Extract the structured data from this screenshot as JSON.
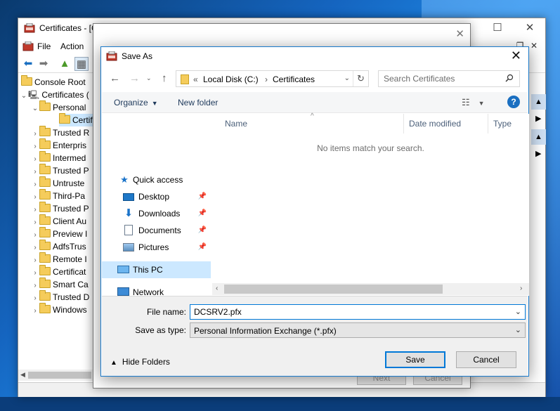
{
  "mmc": {
    "title": "Certificates - [C",
    "menu": [
      "File",
      "Action"
    ],
    "tree": {
      "root": "Console Root",
      "certificates": "Certificates (",
      "personal": "Personal",
      "personal_child": "Certifi",
      "stores": [
        "Trusted R",
        "Enterpris",
        "Intermed",
        "Trusted P",
        "Untruste",
        "Third-Pa",
        "Trusted P",
        "Client Au",
        "Preview I",
        "AdfsTrus",
        "Remote I",
        "Certificat",
        "Smart Ca",
        "Trusted D",
        "Windows"
      ]
    }
  },
  "wizard": {
    "next_label": "Next",
    "cancel_label": "Cancel"
  },
  "dialog": {
    "title": "Save As",
    "breadcrumb": {
      "overflow": "«",
      "items": [
        "Local Disk (C:)",
        "Certificates"
      ]
    },
    "search_placeholder": "Search Certificates",
    "toolbar": {
      "organize": "Organize",
      "new_folder": "New folder"
    },
    "nav_items": {
      "quick_access": "Quick access",
      "desktop": "Desktop",
      "downloads": "Downloads",
      "documents": "Documents",
      "pictures": "Pictures",
      "this_pc": "This PC",
      "network": "Network"
    },
    "columns": {
      "name": "Name",
      "date_modified": "Date modified",
      "type": "Type"
    },
    "empty_message": "No items match your search.",
    "file_name_label": "File name:",
    "file_name_value": "DCSRV2.pfx",
    "save_as_type_label": "Save as type:",
    "save_as_type_value": "Personal Information Exchange (*.pfx)",
    "hide_folders": "Hide Folders",
    "save_label": "Save",
    "cancel_label": "Cancel"
  },
  "colors": {
    "accent": "#0078d7",
    "selection": "#cce8ff",
    "folder": "#f5cc5b"
  }
}
